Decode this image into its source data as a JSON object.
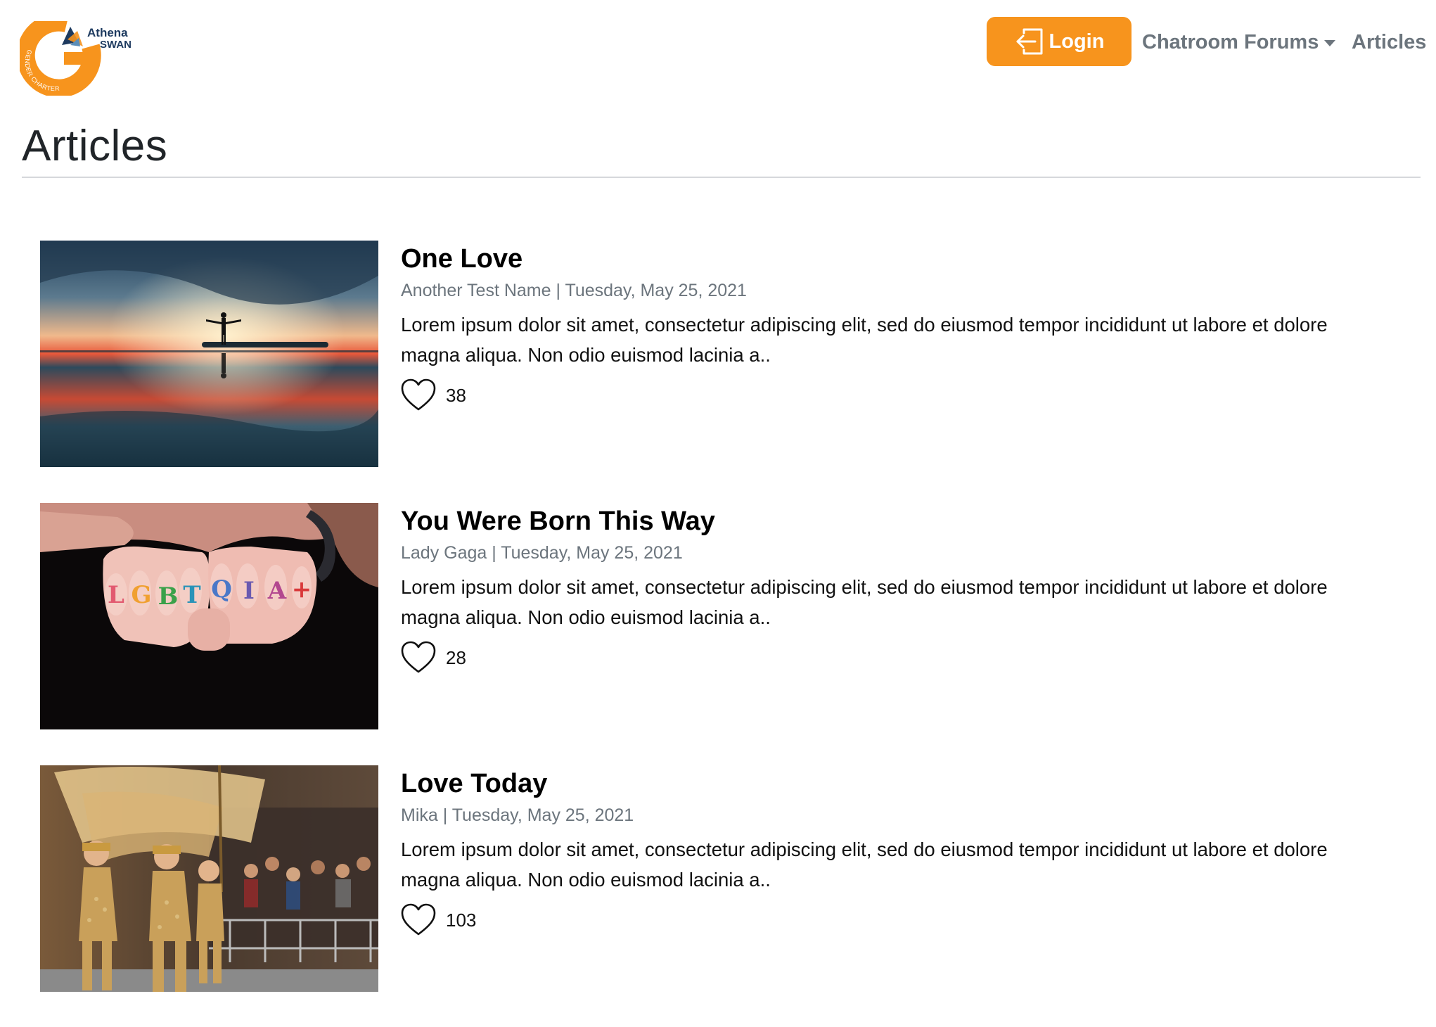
{
  "logo": {
    "line1": "Athena",
    "line2": "SWAN",
    "ring_text": "GENDER CHARTER",
    "brand_color": "#f7941d",
    "navy_color": "#1d3a5f"
  },
  "nav": {
    "login_label": "Login",
    "login_icon": "box-arrow-in-left-icon",
    "dropdown_label": "Chatroom Forums",
    "articles_label": "Articles",
    "accent_color": "#f7941d"
  },
  "page": {
    "title": "Articles"
  },
  "articles": [
    {
      "title": "One Love",
      "author": "Another Test Name",
      "date": "Tuesday, May 25, 2021",
      "meta": "Another Test Name | Tuesday, May 25, 2021",
      "excerpt": "Lorem ipsum dolor sit amet, consectetur adipiscing elit, sed do eiusmod tempor incididunt ut labore et dolore magna aliqua. Non odio euismod lacinia a..",
      "likes": "38",
      "image": "sunset-silhouette-photo"
    },
    {
      "title": "You Were Born This Way",
      "author": "Lady Gaga",
      "date": "Tuesday, May 25, 2021",
      "meta": "Lady Gaga | Tuesday, May 25, 2021",
      "excerpt": "Lorem ipsum dolor sit amet, consectetur adipiscing elit, sed do eiusmod tempor incididunt ut labore et dolore magna aliqua. Non odio euismod lacinia a..",
      "likes": "28",
      "image": "lgbtqia-knuckles-photo",
      "image_lettering": [
        "L",
        "G",
        "B",
        "T",
        "Q",
        "I",
        "A",
        "+"
      ]
    },
    {
      "title": "Love Today",
      "author": "Mika",
      "date": "Tuesday, May 25, 2021",
      "meta": "Mika | Tuesday, May 25, 2021",
      "excerpt": "Lorem ipsum dolor sit amet, consectetur adipiscing elit, sed do eiusmod tempor incididunt ut labore et dolore magna aliqua. Non odio euismod lacinia a..",
      "likes": "103",
      "image": "parade-dancers-photo"
    }
  ]
}
